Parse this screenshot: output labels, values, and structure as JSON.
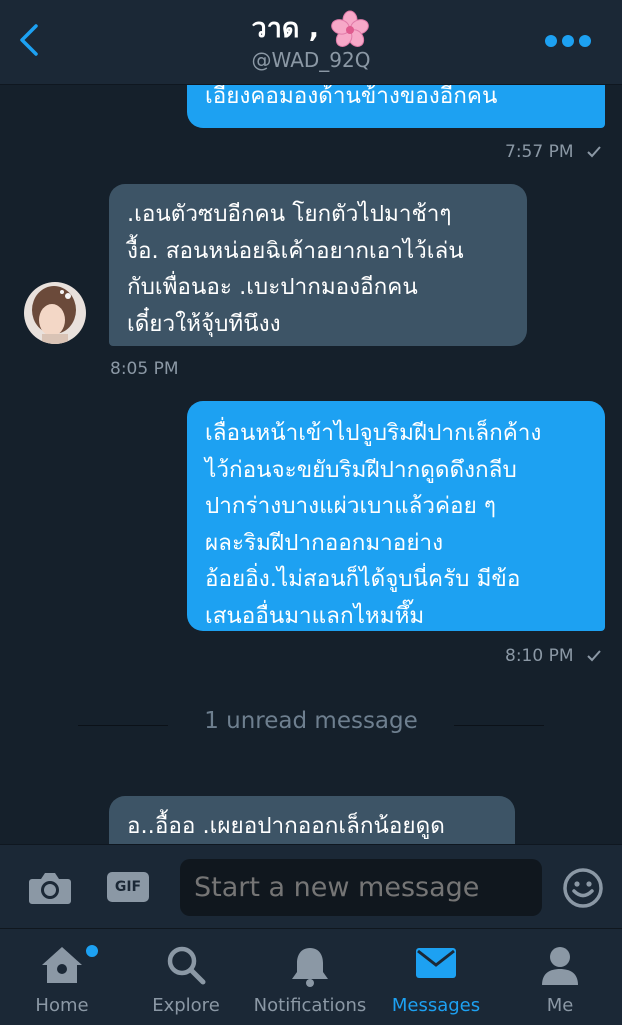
{
  "header": {
    "name": "วาด ,",
    "handle": "@WAD_92Q",
    "back_icon": "chevron-left-icon",
    "more_icon": "more-dots-icon",
    "flower_icon": "cherry-blossom-icon",
    "accent": "#1da1f2"
  },
  "messages": [
    {
      "direction": "out",
      "text": "เอียงคอมองด้านข้างของอีกคน",
      "time": "7:57 PM"
    },
    {
      "direction": "in",
      "text": ".เอนตัวซบอีกคน โยกตัวไปมาช้าๆ\nงื้อ. สอนหน่อยฉิเค้าอยากเอาไว้เล่น\nกับเพื่อนอะ .เบะปากมองอีกคน\nเดี๋ยวให้จุ้บทีนึงง",
      "time": "8:05 PM"
    },
    {
      "direction": "out",
      "text": "เลื่อนหน้าเข้าไปจูบริมฝีปากเล็กค้าง\nไว้ก่อนจะขยับริมฝีปากดูดดึงกลีบ\nปากร่างบางแผ่วเบาแล้วค่อย ๆ\nผละริมฝีปากออกมาอย่าง\nอ้อยอิ่ง.ไม่สอนก็ได้จูบนี่ครับ มีข้อ\nเสนออื่นมาแลกไหมหึ๊ม",
      "time": "8:10 PM"
    },
    {
      "direction": "in",
      "text": "อ..อื้ออ .เผยอปากออกเล็กน้อยดูด"
    }
  ],
  "unread": "1 unread message",
  "composer": {
    "placeholder": "Start a new message",
    "gif_label": "GIF",
    "camera_icon": "camera-icon",
    "emoji_icon": "smiley-icon"
  },
  "tabs": [
    {
      "label": "Home",
      "icon": "home-icon",
      "active": false,
      "badge": true
    },
    {
      "label": "Explore",
      "icon": "search-icon",
      "active": false
    },
    {
      "label": "Notifications",
      "icon": "bell-icon",
      "active": false
    },
    {
      "label": "Messages",
      "icon": "envelope-icon",
      "active": true
    },
    {
      "label": "Me",
      "icon": "person-icon",
      "active": false
    }
  ]
}
